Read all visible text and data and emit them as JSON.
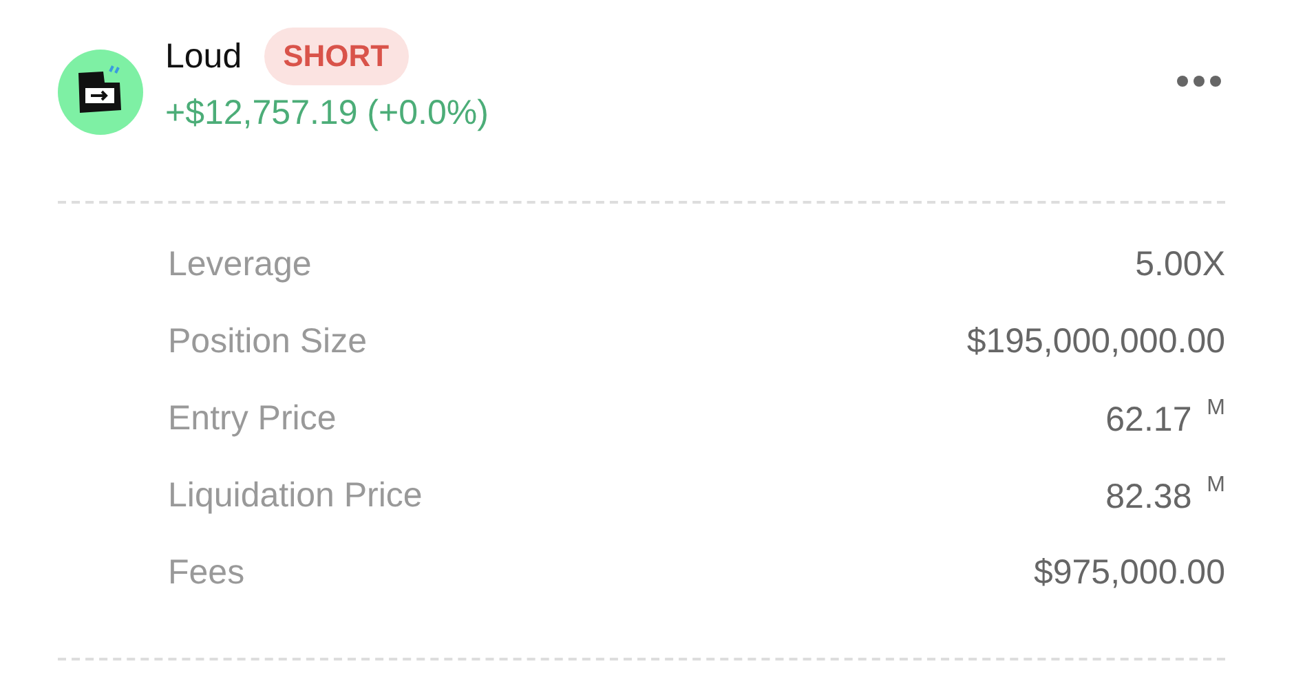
{
  "position": {
    "name": "Loud",
    "side": {
      "label": "SHORT",
      "kind": "short"
    },
    "pnl": "+$12,757.19 (+0.0%)"
  },
  "details": [
    {
      "label": "Leverage",
      "value": "5.00X"
    },
    {
      "label": "Position Size",
      "value": "$195,000,000.00"
    },
    {
      "label": "Entry Price",
      "value": "62.17 $^{M}$"
    },
    {
      "label": "Liquidation Price",
      "value": "82.38 $^{M}$"
    },
    {
      "label": "Fees",
      "value": "$975,000.00"
    }
  ]
}
